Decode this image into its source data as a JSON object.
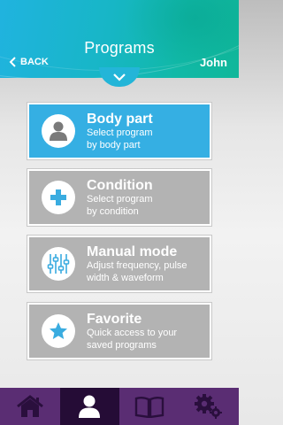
{
  "header": {
    "title": "Programs",
    "back_label": "BACK",
    "user_name": "John"
  },
  "menu": [
    {
      "label": "Body part",
      "desc_line1": "Select program",
      "desc_line2": "by body part",
      "icon": "person-icon",
      "active": true
    },
    {
      "label": "Condition",
      "desc_line1": "Select program",
      "desc_line2": "by condition",
      "icon": "plus-icon",
      "active": false
    },
    {
      "label": "Manual mode",
      "desc_line1": "Adjust frequency, pulse",
      "desc_line2": "width & waveform",
      "icon": "sliders-icon",
      "active": false
    },
    {
      "label": "Favorite",
      "desc_line1": "Quick access to your",
      "desc_line2": "saved programs",
      "icon": "star-icon",
      "active": false
    }
  ],
  "bottom_nav": [
    {
      "icon": "home-icon",
      "selected": false
    },
    {
      "icon": "person-icon",
      "selected": true
    },
    {
      "icon": "book-icon",
      "selected": false
    },
    {
      "icon": "gears-icon",
      "selected": false
    }
  ],
  "colors": {
    "header_start": "#20b3df",
    "header_end": "#10b79a",
    "active_card": "#35afe3",
    "inactive_card": "#b3b3b3",
    "nav_bg": "#5a2d73",
    "nav_selected": "#250c36"
  }
}
